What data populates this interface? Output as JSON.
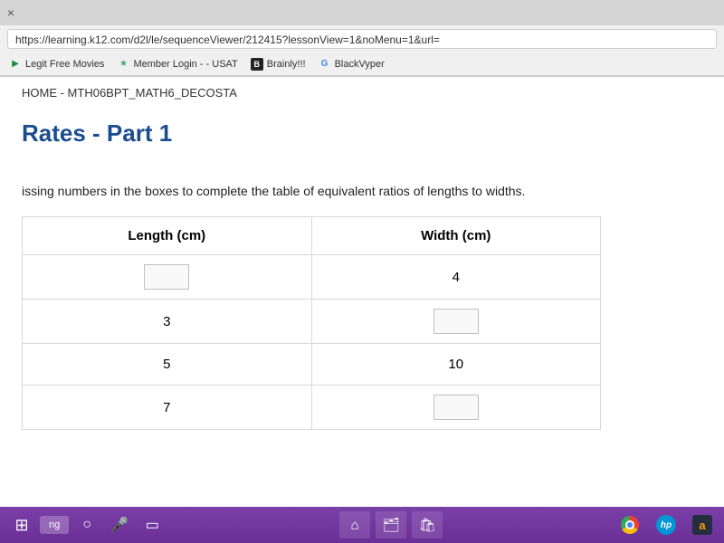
{
  "browser": {
    "url": "https://learning.k12.com/d2l/le/sequenceViewer/212415?lessonView=1&noMenu=1&url=",
    "bookmarks": [
      {
        "label": "Legit Free Movies",
        "iconClass": "bm-play",
        "glyph": "▶"
      },
      {
        "label": "Member Login - - USAT",
        "iconClass": "bm-star",
        "glyph": "★"
      },
      {
        "label": "Brainly!!!",
        "iconClass": "bm-b",
        "glyph": "B"
      },
      {
        "label": "BlackVyper",
        "iconClass": "bm-g",
        "glyph": "G"
      }
    ],
    "close_glyph": "×"
  },
  "page": {
    "breadcrumb": "HOME - MTH06BPT_MATH6_DECOSTA",
    "title_suffix": "Rates - Part 1",
    "instruction_suffix": "issing numbers in the boxes to complete the table of equivalent ratios of lengths to widths.",
    "table": {
      "header_length": "Length (cm)",
      "header_width": "Width (cm)",
      "rows": [
        {
          "length": "",
          "width": "4",
          "length_input": true,
          "width_input": false
        },
        {
          "length": "3",
          "width": "",
          "length_input": false,
          "width_input": true
        },
        {
          "length": "5",
          "width": "10",
          "length_input": false,
          "width_input": false
        },
        {
          "length": "7",
          "width": "",
          "length_input": false,
          "width_input": true
        }
      ]
    }
  },
  "taskbar": {
    "search_label": "ng",
    "hp": "hp",
    "amazon": "a"
  }
}
